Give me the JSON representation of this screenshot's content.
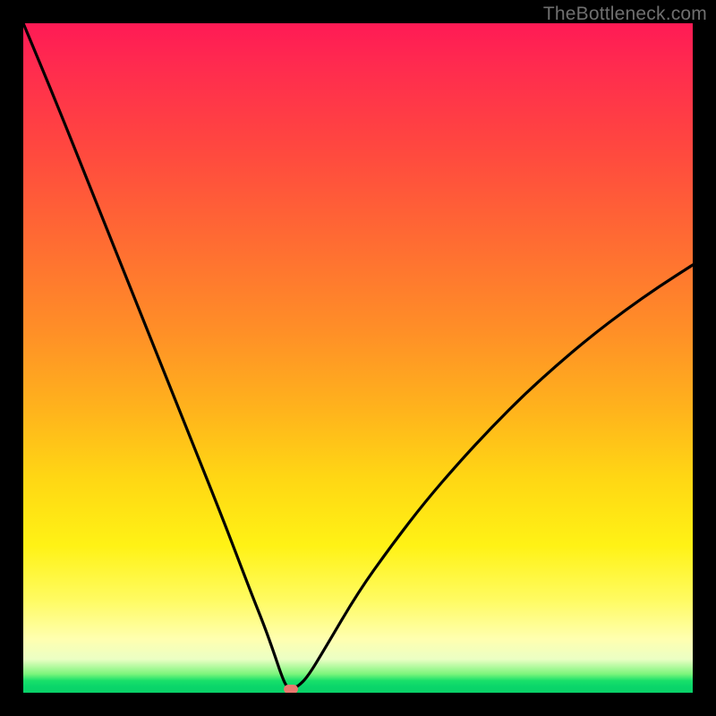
{
  "watermark": "TheBottleneck.com",
  "chart_data": {
    "type": "line",
    "title": "",
    "xlabel": "",
    "ylabel": "",
    "xlim": [
      0,
      100
    ],
    "ylim": [
      0,
      100
    ],
    "grid": false,
    "legend": false,
    "series": [
      {
        "name": "bottleneck-curve",
        "x": [
          0,
          5,
          10,
          15,
          20,
          25,
          30,
          34,
          36,
          37.5,
          38.5,
          39.3,
          40,
          41,
          42.5,
          45,
          50,
          55,
          60,
          65,
          70,
          75,
          80,
          85,
          90,
          95,
          100
        ],
        "y": [
          100,
          88,
          75.5,
          63,
          50.5,
          38,
          25.5,
          15,
          10,
          5.8,
          2.8,
          0.9,
          0.6,
          0.9,
          2.4,
          6.5,
          15,
          22,
          28.5,
          34.3,
          39.7,
          44.7,
          49.2,
          53.4,
          57.2,
          60.7,
          63.9
        ]
      }
    ],
    "marker": {
      "x": 40,
      "y": 0.6,
      "color": "#e9776e"
    },
    "background_gradient": {
      "direction": "vertical",
      "stops": [
        {
          "pos": 0.0,
          "color": "#ff1a55"
        },
        {
          "pos": 0.32,
          "color": "#ff6a33"
        },
        {
          "pos": 0.68,
          "color": "#ffd714"
        },
        {
          "pos": 0.92,
          "color": "#ffffb0"
        },
        {
          "pos": 0.985,
          "color": "#19e06a"
        },
        {
          "pos": 1.0,
          "color": "#09d168"
        }
      ]
    }
  }
}
